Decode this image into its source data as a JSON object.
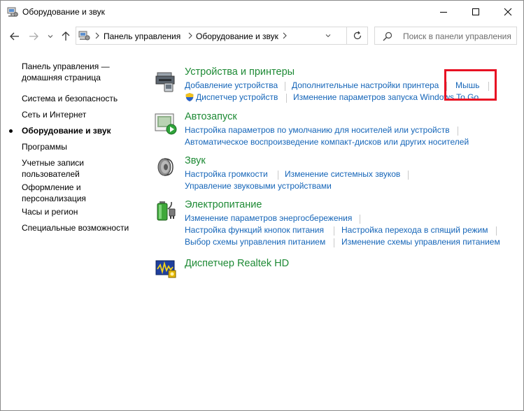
{
  "window": {
    "title": "Оборудование и звук"
  },
  "address": {
    "crumbs": [
      "Панель управления",
      "Оборудование и звук"
    ]
  },
  "search": {
    "placeholder": "Поиск в панели управления"
  },
  "sidebar": {
    "items": [
      {
        "label": "Панель управления —"
      },
      {
        "label": "домашняя страница"
      },
      {
        "label": "Система и безопасность"
      },
      {
        "label": "Сеть и Интернет"
      },
      {
        "label": "Оборудование и звук",
        "active": true
      },
      {
        "label": "Программы"
      },
      {
        "label": "Учетные записи"
      },
      {
        "label": "пользователей"
      },
      {
        "label": "Оформление и"
      },
      {
        "label": "персонализация"
      },
      {
        "label": "Часы и регион"
      },
      {
        "label": "Специальные возможности"
      }
    ]
  },
  "categories": {
    "devices": {
      "title": "Устройства и принтеры",
      "links": [
        "Добавление устройства",
        "Дополнительные настройки принтера",
        "Мышь",
        "Диспетчер устройств",
        "Изменение параметров запуска Windows To Go"
      ]
    },
    "autoplay": {
      "title": "Автозапуск",
      "links": [
        "Настройка параметров по умолчанию для носителей или устройств",
        "Автоматическое воспроизведение компакт-дисков или других носителей"
      ]
    },
    "sound": {
      "title": "Звук",
      "links": [
        "Настройка громкости",
        "Изменение системных звуков",
        "Управление звуковыми устройствами"
      ]
    },
    "power": {
      "title": "Электропитание",
      "links": [
        "Изменение параметров энергосбережения",
        "Настройка функций кнопок питания",
        "Настройка перехода в спящий режим",
        "Выбор схемы управления питанием",
        "Изменение схемы управления питанием"
      ]
    },
    "realtek": {
      "title": "Диспетчер Realtek HD"
    }
  },
  "colors": {
    "category_title": "#1e8a35",
    "link": "#1565b8",
    "highlight": "#e81123"
  },
  "icons": {
    "devices": "printer-device-icon",
    "device_manager": "uac-shield-icon",
    "autoplay": "autoplay-icon",
    "sound": "speaker-icon",
    "power": "battery-icon",
    "realtek": "realtek-audio-icon"
  }
}
